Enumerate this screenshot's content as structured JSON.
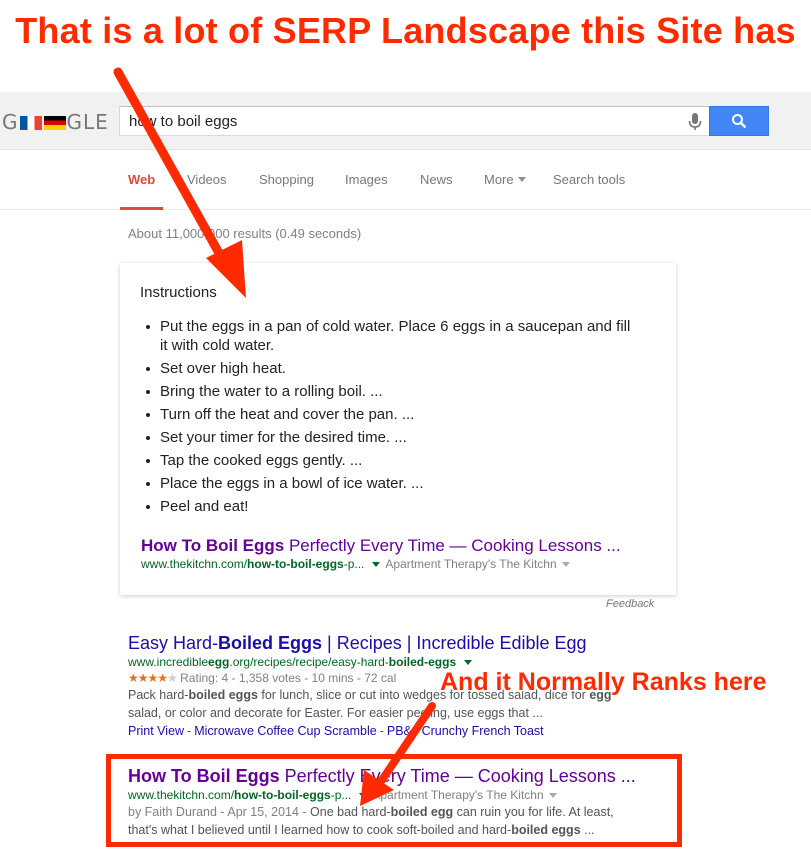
{
  "annotations": {
    "top": "That is a lot of SERP Landscape this Site has",
    "bottom": "And it Normally Ranks here"
  },
  "header": {
    "logo_left": "G",
    "logo_right": "GLE",
    "search_value": "how to boil eggs"
  },
  "tabs": [
    {
      "label": "Web",
      "active": true
    },
    {
      "label": "Videos"
    },
    {
      "label": "Shopping"
    },
    {
      "label": "Images"
    },
    {
      "label": "News"
    },
    {
      "label": "More"
    },
    {
      "label": "Search tools"
    }
  ],
  "stats": "About 11,000,000 results (0.49 seconds)",
  "answer_box": {
    "heading": "Instructions",
    "steps": [
      "Put the eggs in a pan of cold water. Place 6 eggs in a saucepan and fill it with cold water.",
      "Set over high heat.",
      "Bring the water to a rolling boil. ...",
      "Turn off the heat and cover the pan. ...",
      "Set your timer for the desired time. ...",
      "Tap the cooked eggs gently. ...",
      "Place the eggs in a bowl of ice water. ...",
      "Peel and eat!"
    ],
    "link_bold": "How To Boil Eggs",
    "link_rest": " Perfectly Every Time — Cooking Lessons ...",
    "url_plain": "www.thekitchn.com/",
    "url_bold": "how-to-boil-eggs",
    "url_tail": "-p...",
    "source": "Apartment Therapy's The Kitchn",
    "feedback": "Feedback"
  },
  "results": [
    {
      "title_a": "Easy Hard-",
      "title_b": "Boiled Eggs",
      "title_c": " | Recipes | Incredible Edible Egg",
      "url_a": "www.incredible",
      "url_b": "egg",
      "url_c": ".org/recipes/recipe/easy-hard-",
      "url_d": "boiled-eggs",
      "stars": "★★★★",
      "stars_empty": "★",
      "rating": "Rating: 4 - 1,358 votes - 10 mins - 72 cal",
      "snippet_1a": "Pack hard-",
      "snippet_1b": "boiled eggs",
      "snippet_1c": " for lunch, slice or cut into wedges for tossed salad, dice for ",
      "snippet_1d": "egg",
      "snippet_2": "salad, or color and decorate for Easter. For easier peeling, use eggs that ...",
      "sitelinks": [
        "Print View",
        "Microwave Coffee Cup Scramble",
        "PB&J Crunchy French Toast"
      ],
      "sitelink_sep": "-"
    },
    {
      "title_a": "How To Boil Eggs",
      "title_b": " Perfectly Every Time — Cooking Lessons ...",
      "url_a": "www.thekitchn.com/",
      "url_b": "how-to-boil-eggs",
      "url_c": "-p...",
      "source": "Apartment Therapy's The Kitchn",
      "byline": "by Faith Durand - Apr 15, 2014 - ",
      "snippet_1a": "One bad hard-",
      "snippet_1b": "boiled egg",
      "snippet_1c": " can ruin you for life. At least,",
      "snippet_2a": "that's what I believed until I learned how to cook soft-boiled and hard-",
      "snippet_2b": "boiled eggs",
      "snippet_2c": " ..."
    }
  ],
  "colors": {
    "annotation": "#ff2a00",
    "link": "#1a0dab",
    "visited": "#660099",
    "url": "#006621",
    "search_button": "#4285f4",
    "active_tab": "#dd4b39"
  },
  "icons": [
    "microphone-icon",
    "search-icon",
    "flag-fr-icon",
    "flag-de-icon"
  ]
}
